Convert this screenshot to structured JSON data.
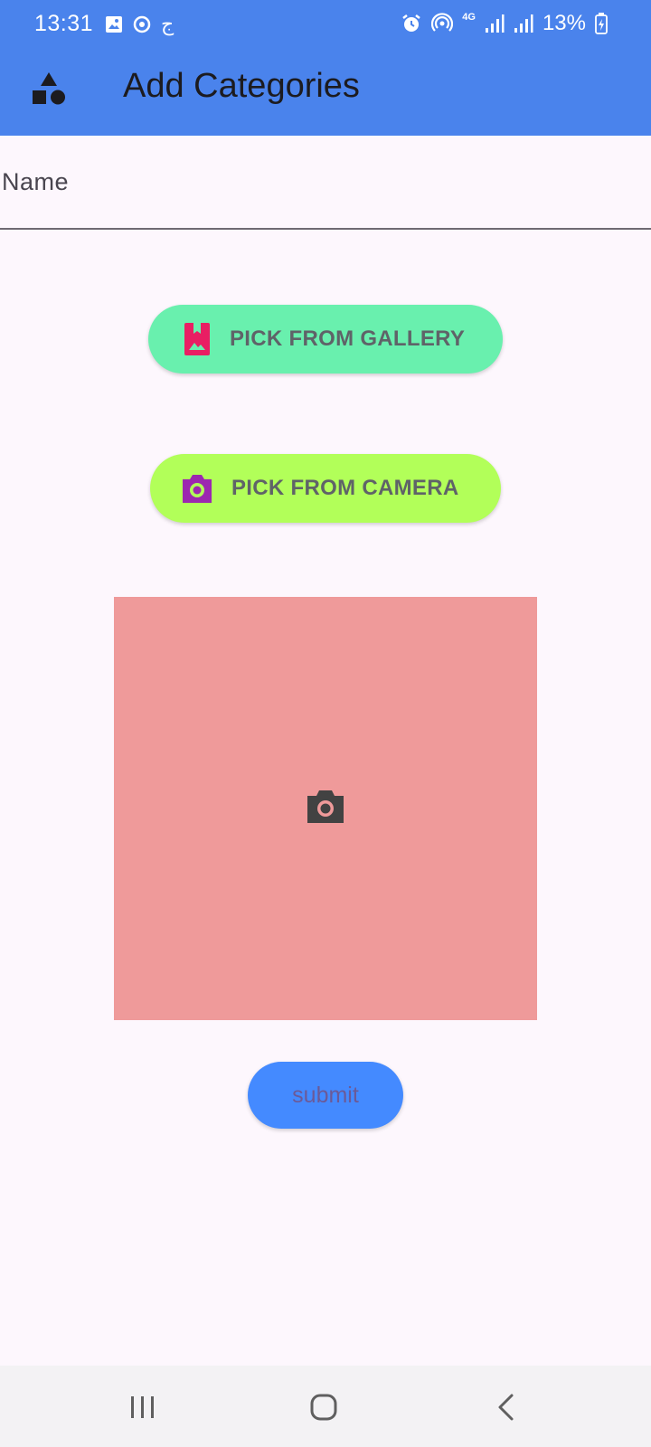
{
  "status_bar": {
    "time": "13:31",
    "left_icons": [
      "image-icon",
      "sync-icon",
      "arabic-char-icon"
    ],
    "arabic_char": "ج",
    "right_icons": [
      "alarm-icon",
      "hotspot-icon",
      "network-4g-icon",
      "signal-icon",
      "signal-icon"
    ],
    "network_label": "4G",
    "battery": "13%"
  },
  "app_bar": {
    "icon": "category-shapes-icon",
    "title": "Add Categories",
    "color": "#4a83ec"
  },
  "name_field": {
    "label": "Name"
  },
  "gallery_button": {
    "label": "PICK FROM GALLERY",
    "icon": "photo-album-icon",
    "icon_color": "#e91e63",
    "color": "#69f0ae"
  },
  "camera_button": {
    "label": "PICK FROM CAMERA",
    "icon": "camera-icon",
    "icon_color": "#9c27b0",
    "color": "#b2ff59"
  },
  "image_preview": {
    "icon": "camera-icon",
    "color": "#ef9a9a"
  },
  "submit_button": {
    "label": "submit",
    "color": "#448aff"
  },
  "nav_bar": {
    "items": [
      "recents-icon",
      "home-icon",
      "back-icon"
    ]
  }
}
